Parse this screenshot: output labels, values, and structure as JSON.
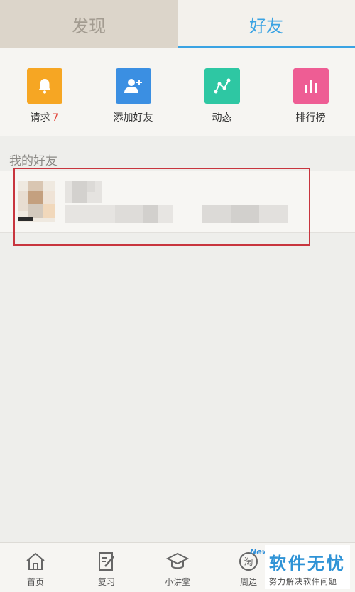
{
  "tabs": [
    {
      "label": "发现",
      "active": false
    },
    {
      "label": "好友",
      "active": true
    }
  ],
  "features": [
    {
      "label": "请求",
      "count": "7",
      "color": "#f6a623",
      "icon": "bell-icon"
    },
    {
      "label": "添加好友",
      "count": "",
      "color": "#3b8fe2",
      "icon": "add-user-icon"
    },
    {
      "label": "动态",
      "count": "",
      "color": "#2ec7a3",
      "icon": "trend-icon"
    },
    {
      "label": "排行榜",
      "count": "",
      "color": "#ee5d94",
      "icon": "bar-chart-icon"
    }
  ],
  "friends_section": {
    "title": "我的好友"
  },
  "bottom_nav": [
    {
      "label": "首页",
      "icon": "home-icon"
    },
    {
      "label": "复习",
      "icon": "notebook-icon"
    },
    {
      "label": "小讲堂",
      "icon": "graduation-cap-icon"
    },
    {
      "label": "周边",
      "icon": "tao-icon",
      "icon_text": "淘",
      "badge": "New"
    }
  ],
  "watermark": {
    "title": "软件无忧",
    "subtitle": "努力解决软件问题"
  },
  "colors": {
    "accent": "#3aa3e3",
    "highlight": "#c8353e",
    "count": "#e2483d"
  }
}
